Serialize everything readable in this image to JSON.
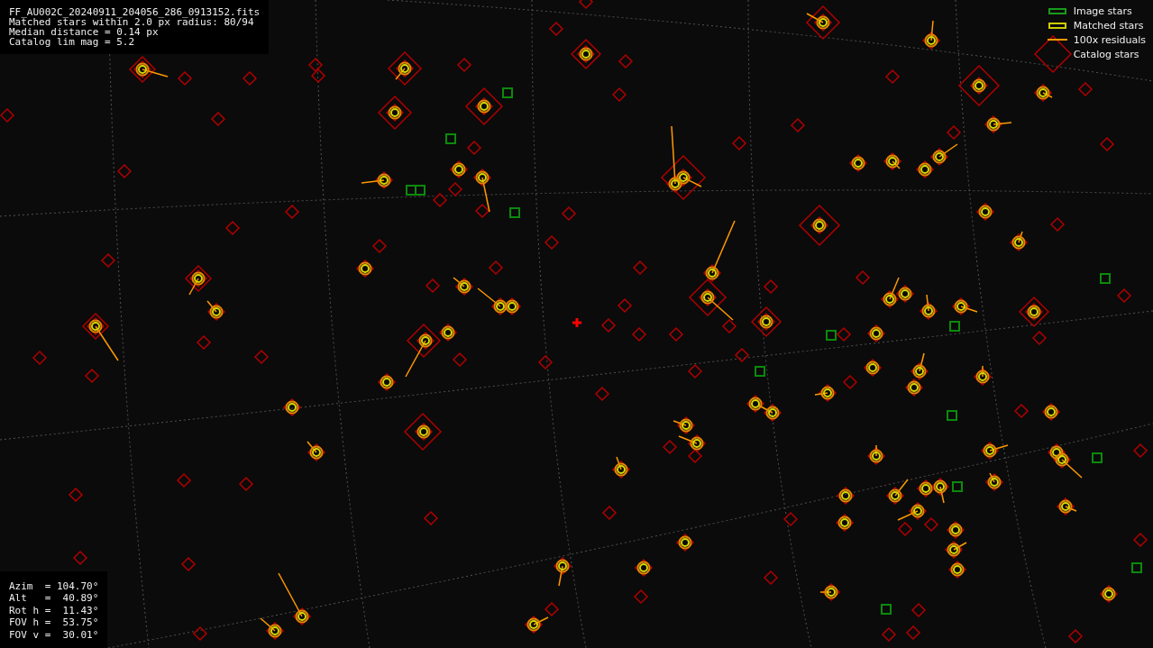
{
  "header": {
    "lines": [
      "FF_AU002C_20240911_204056_286_0913152.fits",
      "Matched stars within 2.0 px radius: 80/94",
      "Median distance = 0.14 px",
      "Catalog lim mag = 5.2"
    ]
  },
  "legend": [
    {
      "kind": "image",
      "label": "Image stars"
    },
    {
      "kind": "matched",
      "label": "Matched stars"
    },
    {
      "kind": "residual",
      "label": "100x residuals"
    },
    {
      "kind": "catalog",
      "label": "Catalog stars"
    }
  ],
  "pointing": {
    "lines": [
      "Azim  = 104.70°",
      "Alt   =  40.89°",
      "Rot h =  11.43°",
      "FOV h =  53.75°",
      "FOV v =  30.01°"
    ]
  }
}
